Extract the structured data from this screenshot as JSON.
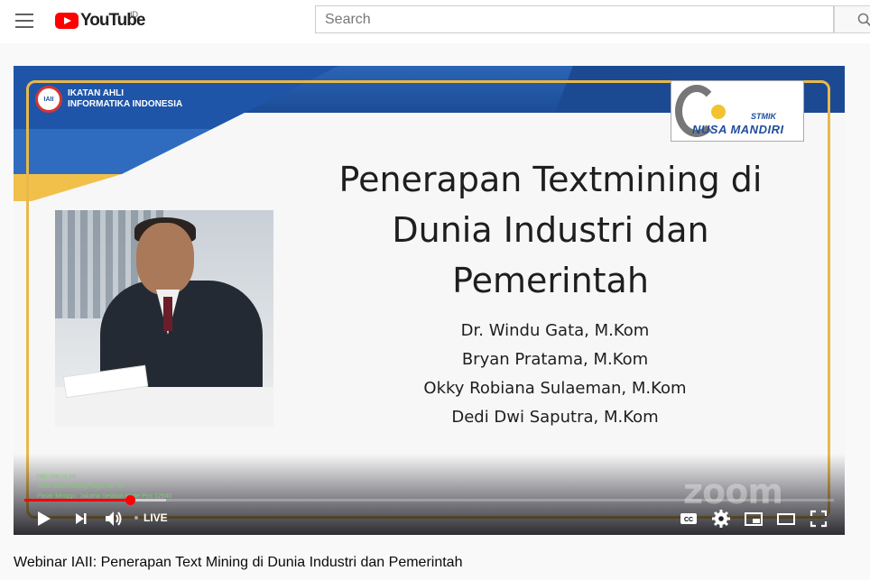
{
  "masthead": {
    "logo_text": "YouTube",
    "country_code": "ID",
    "search_placeholder": "Search"
  },
  "slide": {
    "org_name_line1": "IKATAN AHLI",
    "org_name_line2": "INFORMATIKA INDONESIA",
    "org_badge": "IAII",
    "campus_logo_top": "STMIK",
    "campus_logo_bottom": "NUSA MANDIRI",
    "title_line1": "Penerapan Textmining di",
    "title_line2": "Dunia Industri dan",
    "title_line3": "Pemerintah",
    "authors": [
      "Dr. Windu Gata, M.Kom",
      "Bryan Pratama, M.Kom",
      "Okky Robiana Sulaeman, M.Kom",
      "Dedi Dwi Saputra, M.Kom"
    ],
    "footer_url": "http://iaii.or.id/",
    "footer_address": "Jalan Jati Padang Raya No. 41",
    "footer_city": "Pasar Minggu, Jakarta Selatan Kode Pos 12540",
    "watermark": "zoom"
  },
  "player": {
    "live_label": "LIVE",
    "progress_fraction": 0.13
  },
  "video": {
    "title": "Webinar IAII: Penerapan Text Mining di Dunia Industri dan Pemerintah"
  },
  "colors": {
    "brand_red": "#ff0000",
    "slide_blue": "#1f4e9c",
    "frame_gold": "#e8b84a"
  }
}
